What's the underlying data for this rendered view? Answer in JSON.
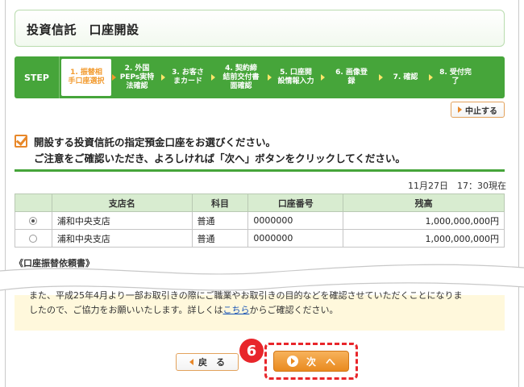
{
  "header": {
    "title": "投資信託　口座開設"
  },
  "steps": {
    "label": "STEP",
    "items": [
      {
        "label": "1. 振替相手口座選択",
        "lines": [
          "1. 振替相",
          "手口座選択"
        ],
        "active": true
      },
      {
        "label": "2. 外国PEPs実特法確認",
        "lines": [
          "2. 外国",
          "PEPs実特",
          "法確認"
        ],
        "active": false
      },
      {
        "label": "3. お客さまカード",
        "lines": [
          "3. お客さ",
          "まカード"
        ],
        "active": false
      },
      {
        "label": "4. 契約締結前交付書面確認",
        "lines": [
          "4. 契約締",
          "結前交付書",
          "面確認"
        ],
        "active": false
      },
      {
        "label": "5. 口座開設情報入力",
        "lines": [
          "5. 口座開",
          "設情報入力"
        ],
        "active": false
      },
      {
        "label": "6. 画像登録",
        "lines": [
          "6. 画像登",
          "録"
        ],
        "active": false
      },
      {
        "label": "7. 確認",
        "lines": [
          "7. 確認"
        ],
        "active": false
      },
      {
        "label": "8. 受付完了",
        "lines": [
          "8. 受付完",
          "了"
        ],
        "active": false
      }
    ]
  },
  "toolbar": {
    "stop_label": "中止する"
  },
  "instruction": {
    "line1": "開設する投資信託の指定預金口座をお選びください。",
    "line2": "ご注意をご確認いただき、よろしければ「次へ」ボタンをクリックしてください。"
  },
  "timestamp": "11月27日　17：30現在",
  "table": {
    "headers": [
      "",
      "支店名",
      "科目",
      "口座番号",
      "残高"
    ],
    "rows": [
      {
        "selected": true,
        "branch": "浦和中央支店",
        "type": "普通",
        "account": "0000000",
        "balance": "1,000,000,000円"
      },
      {
        "selected": false,
        "branch": "浦和中央支店",
        "type": "普通",
        "account": "0000000",
        "balance": "1,000,000,000円"
      }
    ]
  },
  "section_cut_title": "《口座振替依頼書》",
  "notice": {
    "line1": "また、平成25年4月より一部お取引きの際にご職業やお取引きの目的などを確認させていただくことになりま",
    "line2_prefix": "したので、ご協力をお願いいたします。詳しくは",
    "line2_link": "こちら",
    "line2_suffix": "からご確認ください。"
  },
  "buttons": {
    "back_label": "戻　る",
    "next_label": "次　へ"
  },
  "badge": {
    "number": "6"
  },
  "colors": {
    "accent_green": "#46a53a",
    "accent_orange": "#e98a1f",
    "highlight_red": "#e8262b"
  }
}
